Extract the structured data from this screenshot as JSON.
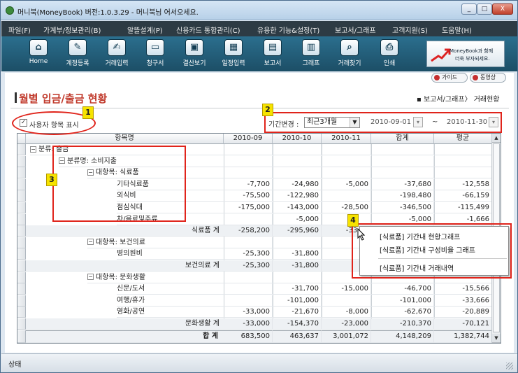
{
  "window": {
    "title": "머니북(MoneyBook) 버전:1.0.3.29 - 머니북님 어서오세요.",
    "controls": [
      "_",
      "□",
      "X"
    ]
  },
  "menu": [
    "파일(F)",
    "가계부/정보관리(B)",
    "알뜰설계(P)",
    "신용카드 통합관리(C)",
    "유용한 기능&설정(T)",
    "보고서/그래프",
    "고객지원(S)",
    "도움말(H)"
  ],
  "toolbar": [
    {
      "label": "Home",
      "icon": "home-icon",
      "glyph": "⌂"
    },
    {
      "label": "계정등록",
      "icon": "account-register-icon",
      "glyph": "✎"
    },
    {
      "label": "거래입력",
      "icon": "transaction-input-icon",
      "glyph": "✍"
    },
    {
      "label": "청구서",
      "icon": "card-bill-icon",
      "glyph": "▭"
    },
    {
      "label": "결산보기",
      "icon": "settlement-icon",
      "glyph": "▣"
    },
    {
      "label": "일정입력",
      "icon": "calendar-icon",
      "glyph": "▦"
    },
    {
      "label": "보고서",
      "icon": "report-icon",
      "glyph": "▤"
    },
    {
      "label": "그래프",
      "icon": "graph-icon",
      "glyph": "▥"
    },
    {
      "label": "거래찾기",
      "icon": "search-icon",
      "glyph": "⌕"
    },
    {
      "label": "인쇄",
      "icon": "print-icon",
      "glyph": "⎙"
    }
  ],
  "banner": {
    "line1": "MoneyBook과 함께",
    "line2": "더욱 부자되세요."
  },
  "side_buttons": {
    "guide": "가이드",
    "video": "동영상"
  },
  "page": {
    "title": "월별 입금/출금 현황",
    "breadcrumb": "▪ 보고서/그래프〉 거래현황"
  },
  "filters": {
    "custom_items_label": "사용자 항목 표시",
    "custom_items_checked": true,
    "period_label": "기간변경 :",
    "period_value": "최근3개월",
    "date_from": "2010-09-01",
    "date_sep": "~",
    "date_to": "2010-11-30"
  },
  "table": {
    "columns": [
      "항목명",
      "2010-09",
      "2010-10",
      "2010-11",
      "합계",
      "평균"
    ],
    "rows": [
      {
        "level": 0,
        "toggle": "−",
        "name": "분류: 출금",
        "values": [
          "",
          "",
          "",
          "",
          ""
        ]
      },
      {
        "level": 1,
        "toggle": "−",
        "name": "분류명: 소비지출",
        "values": [
          "",
          "",
          "",
          "",
          ""
        ]
      },
      {
        "level": 2,
        "toggle": "−",
        "name": "대항목: 식료품",
        "values": [
          "",
          "",
          "",
          "",
          ""
        ]
      },
      {
        "level": 3,
        "name": "기타식료품",
        "values": [
          "-7,700",
          "-24,980",
          "-5,000",
          "-37,680",
          "-12,558"
        ]
      },
      {
        "level": 3,
        "name": "외식비",
        "values": [
          "-75,500",
          "-122,980",
          "",
          "-198,480",
          "-66,159"
        ]
      },
      {
        "level": 3,
        "name": "점심식대",
        "values": [
          "-175,000",
          "-143,000",
          "-28,500",
          "-346,500",
          "-115,499"
        ]
      },
      {
        "level": 3,
        "name": "차/음료및주류",
        "values": [
          "",
          "-5,000",
          "",
          "-5,000",
          "-1,666"
        ]
      },
      {
        "level": 3,
        "subtotal": true,
        "name": "식료품 계",
        "values": [
          "-258,200",
          "-295,960",
          "-33,50",
          "-587,660",
          "-195,882"
        ]
      },
      {
        "level": 2,
        "toggle": "−",
        "name": "대항목: 보건의료",
        "values": [
          "",
          "",
          "",
          "",
          ""
        ]
      },
      {
        "level": 3,
        "name": "병의원비",
        "values": [
          "-25,300",
          "-31,800",
          "",
          "",
          ""
        ]
      },
      {
        "level": 3,
        "subtotal": true,
        "name": "보건의료 계",
        "values": [
          "-25,300",
          "-31,800",
          "0",
          "",
          ""
        ]
      },
      {
        "level": 2,
        "toggle": "−",
        "name": "대항목: 문화생활",
        "values": [
          "",
          "",
          "",
          "",
          ""
        ]
      },
      {
        "level": 3,
        "name": "신문/도서",
        "values": [
          "",
          "-31,700",
          "-15,000",
          "-46,700",
          "-15,566"
        ]
      },
      {
        "level": 3,
        "name": "여행/휴가",
        "values": [
          "",
          "-101,000",
          "",
          "-101,000",
          "-33,666"
        ]
      },
      {
        "level": 3,
        "name": "영화/공연",
        "values": [
          "-33,000",
          "-21,670",
          "-8,000",
          "-62,670",
          "-20,889"
        ]
      },
      {
        "level": 3,
        "subtotal": true,
        "name": "문화생활 계",
        "values": [
          "-33,000",
          "-154,370",
          "-23,000",
          "-210,370",
          "-70,121"
        ]
      }
    ],
    "total": {
      "name": "합 계",
      "values": [
        "683,500",
        "463,637",
        "3,001,072",
        "4,148,209",
        "1,382,744"
      ]
    }
  },
  "context_menu": [
    "[식료품] 기간내 현황그래프",
    "[식료품] 기간내 구성비율 그래프",
    "[식료품] 기간내 거래내역"
  ],
  "annotations": [
    "1",
    "2",
    "3",
    "4"
  ],
  "status": {
    "label": "상태"
  },
  "colors": {
    "title_red": "#c0392b",
    "annotation_red": "#e0241b",
    "badge_yellow": "#f6e300",
    "toolbar_teal": "#236384",
    "menubar_dark": "#2d3b44"
  }
}
